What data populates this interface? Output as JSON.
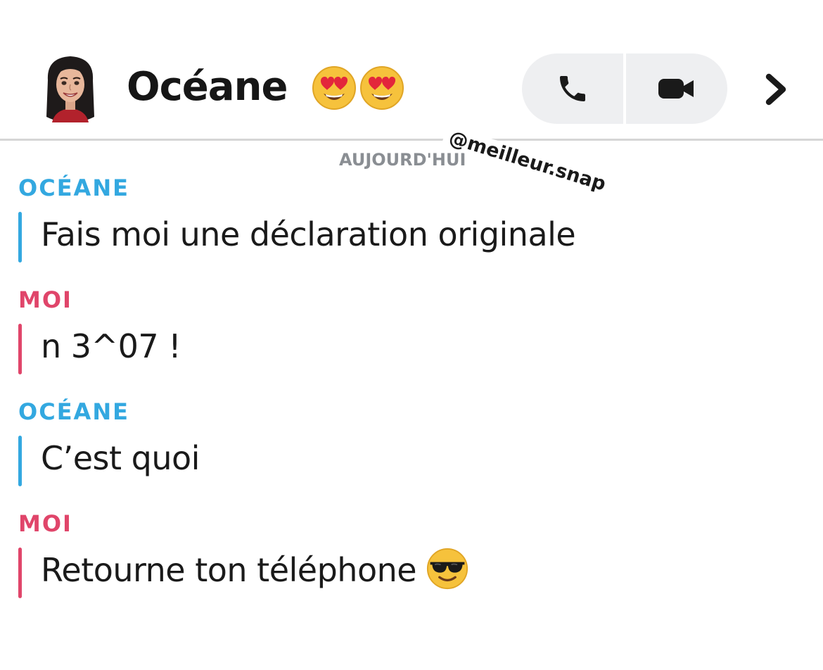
{
  "header": {
    "contact_name": "Océane",
    "name_emojis": [
      "heart-eyes",
      "heart-eyes"
    ]
  },
  "watermark": "@meilleur.snap",
  "date_label": "AUJOURD'HUI",
  "messages": [
    {
      "sender": "OCÉANE",
      "text": "Fais moi une déclaration originale",
      "from": "them"
    },
    {
      "sender": "MOI",
      "text": "n 3^07 !",
      "from": "me"
    },
    {
      "sender": "OCÉANE",
      "text": "C’est quoi",
      "from": "them"
    },
    {
      "sender": "MOI",
      "text": "Retourne ton téléphone",
      "from": "me",
      "emoji": "sunglasses"
    }
  ],
  "colors": {
    "them": "#33a8e0",
    "me": "#e0456a",
    "call_group_bg": "#eeeff1",
    "date_label": "#8a8e93"
  },
  "icons": {
    "call": "phone-icon",
    "video": "video-camera-icon",
    "more": "chevron-right-icon"
  }
}
